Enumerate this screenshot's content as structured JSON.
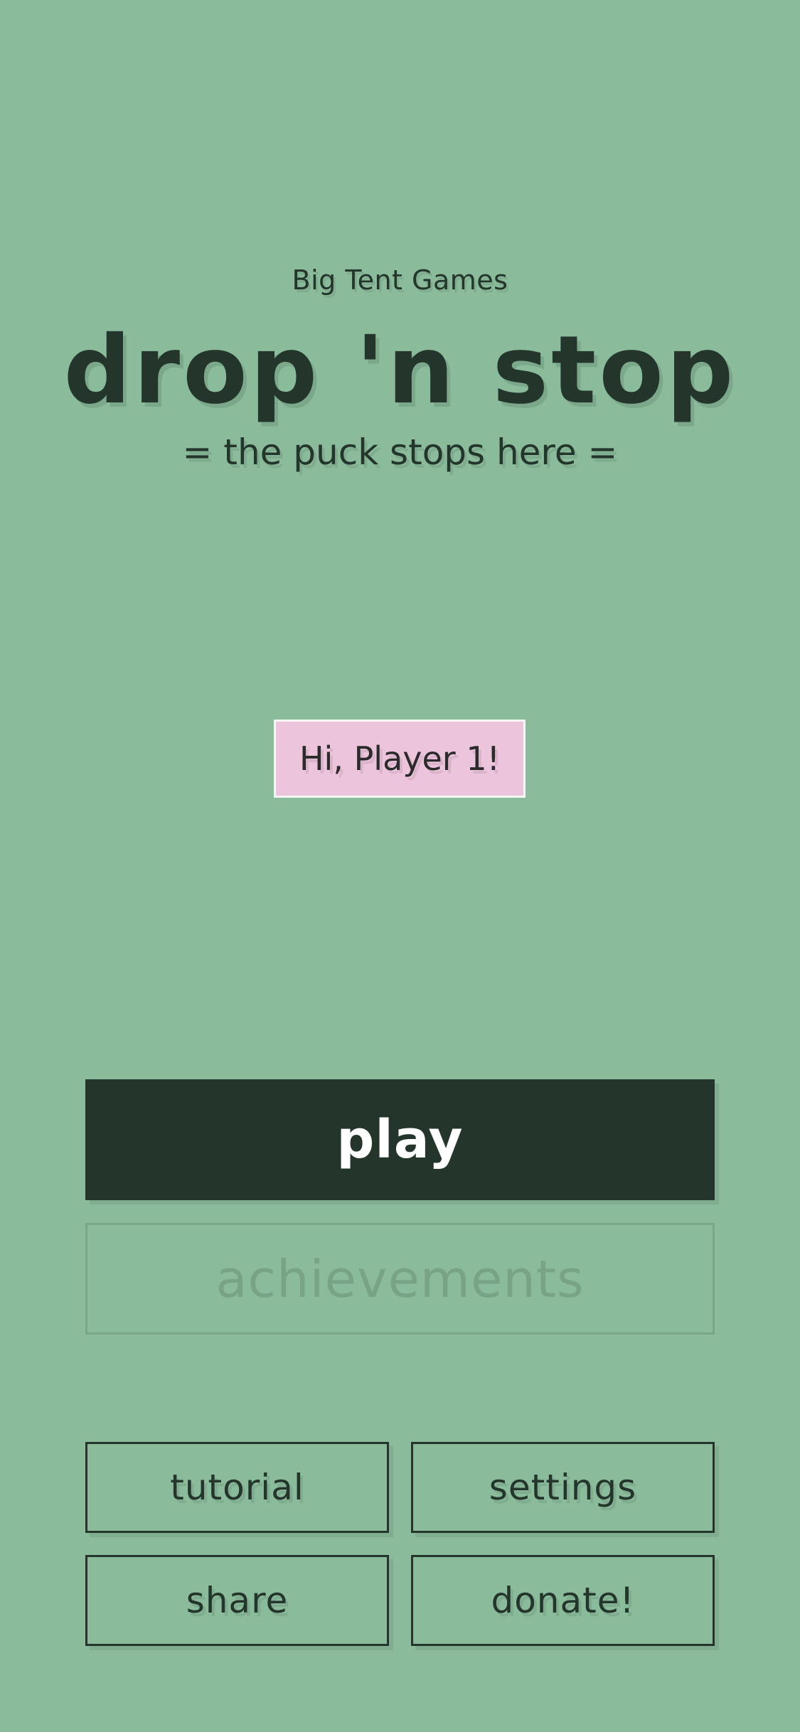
{
  "header": {
    "studio": "Big Tent Games",
    "title": "drop 'n stop",
    "tagline": "= the puck stops here ="
  },
  "greeting": {
    "text": "Hi, Player 1!"
  },
  "menu": {
    "play_label": "play",
    "achievements_label": "achievements",
    "tutorial_label": "tutorial",
    "settings_label": "settings",
    "share_label": "share",
    "donate_label": "donate!"
  },
  "colors": {
    "background": "#8abb9b",
    "primary_dark": "#24362c",
    "greeting_bg": "#ecc4dc",
    "disabled_text": "#78a387"
  }
}
